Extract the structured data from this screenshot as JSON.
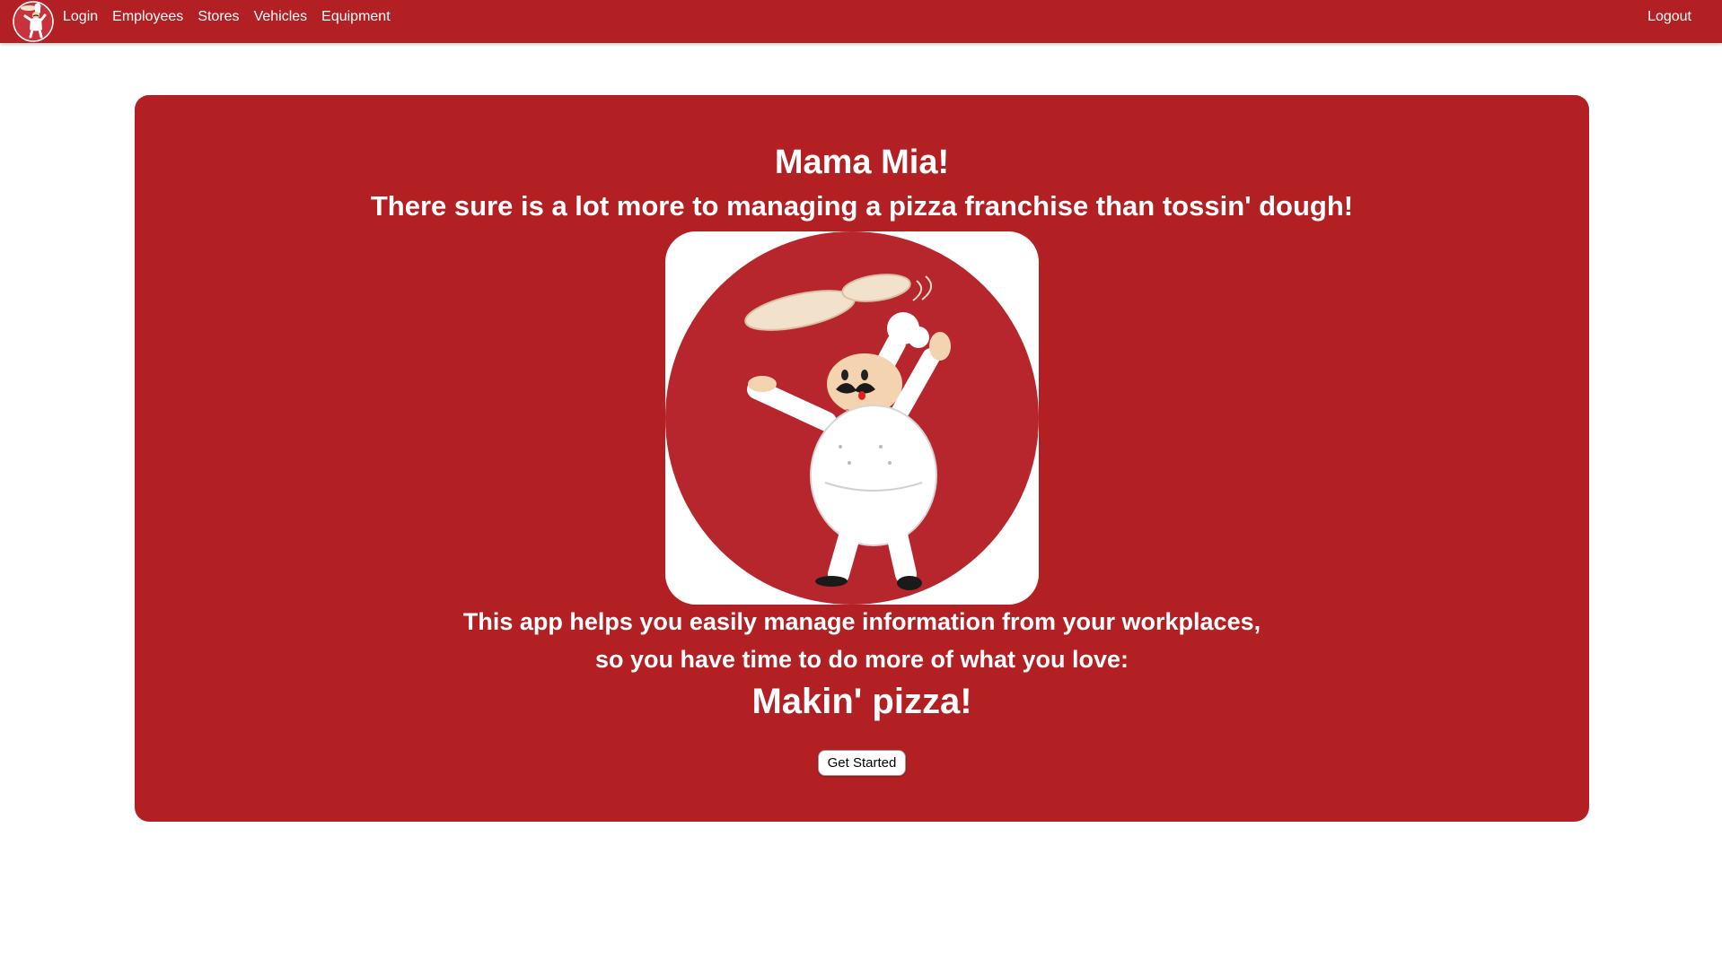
{
  "nav": {
    "logo_icon": "chef-logo-icon",
    "links": [
      "Login",
      "Employees",
      "Stores",
      "Vehicles",
      "Equipment"
    ],
    "logout": "Logout"
  },
  "hero": {
    "title": "Mama Mia!",
    "subtitle": "There sure is a lot more to managing a pizza franchise than tossin' dough!",
    "image_icon": "pizza-chef-illustration",
    "description_line1": "This app helps you easily manage information from your workplaces,",
    "description_line2": "so you have time to do more of what you love:",
    "tagline": "Makin' pizza!",
    "button_label": "Get Started"
  },
  "colors": {
    "brand_red": "#b22024",
    "chef_circle": "#b8262d",
    "white": "#ffffff"
  }
}
